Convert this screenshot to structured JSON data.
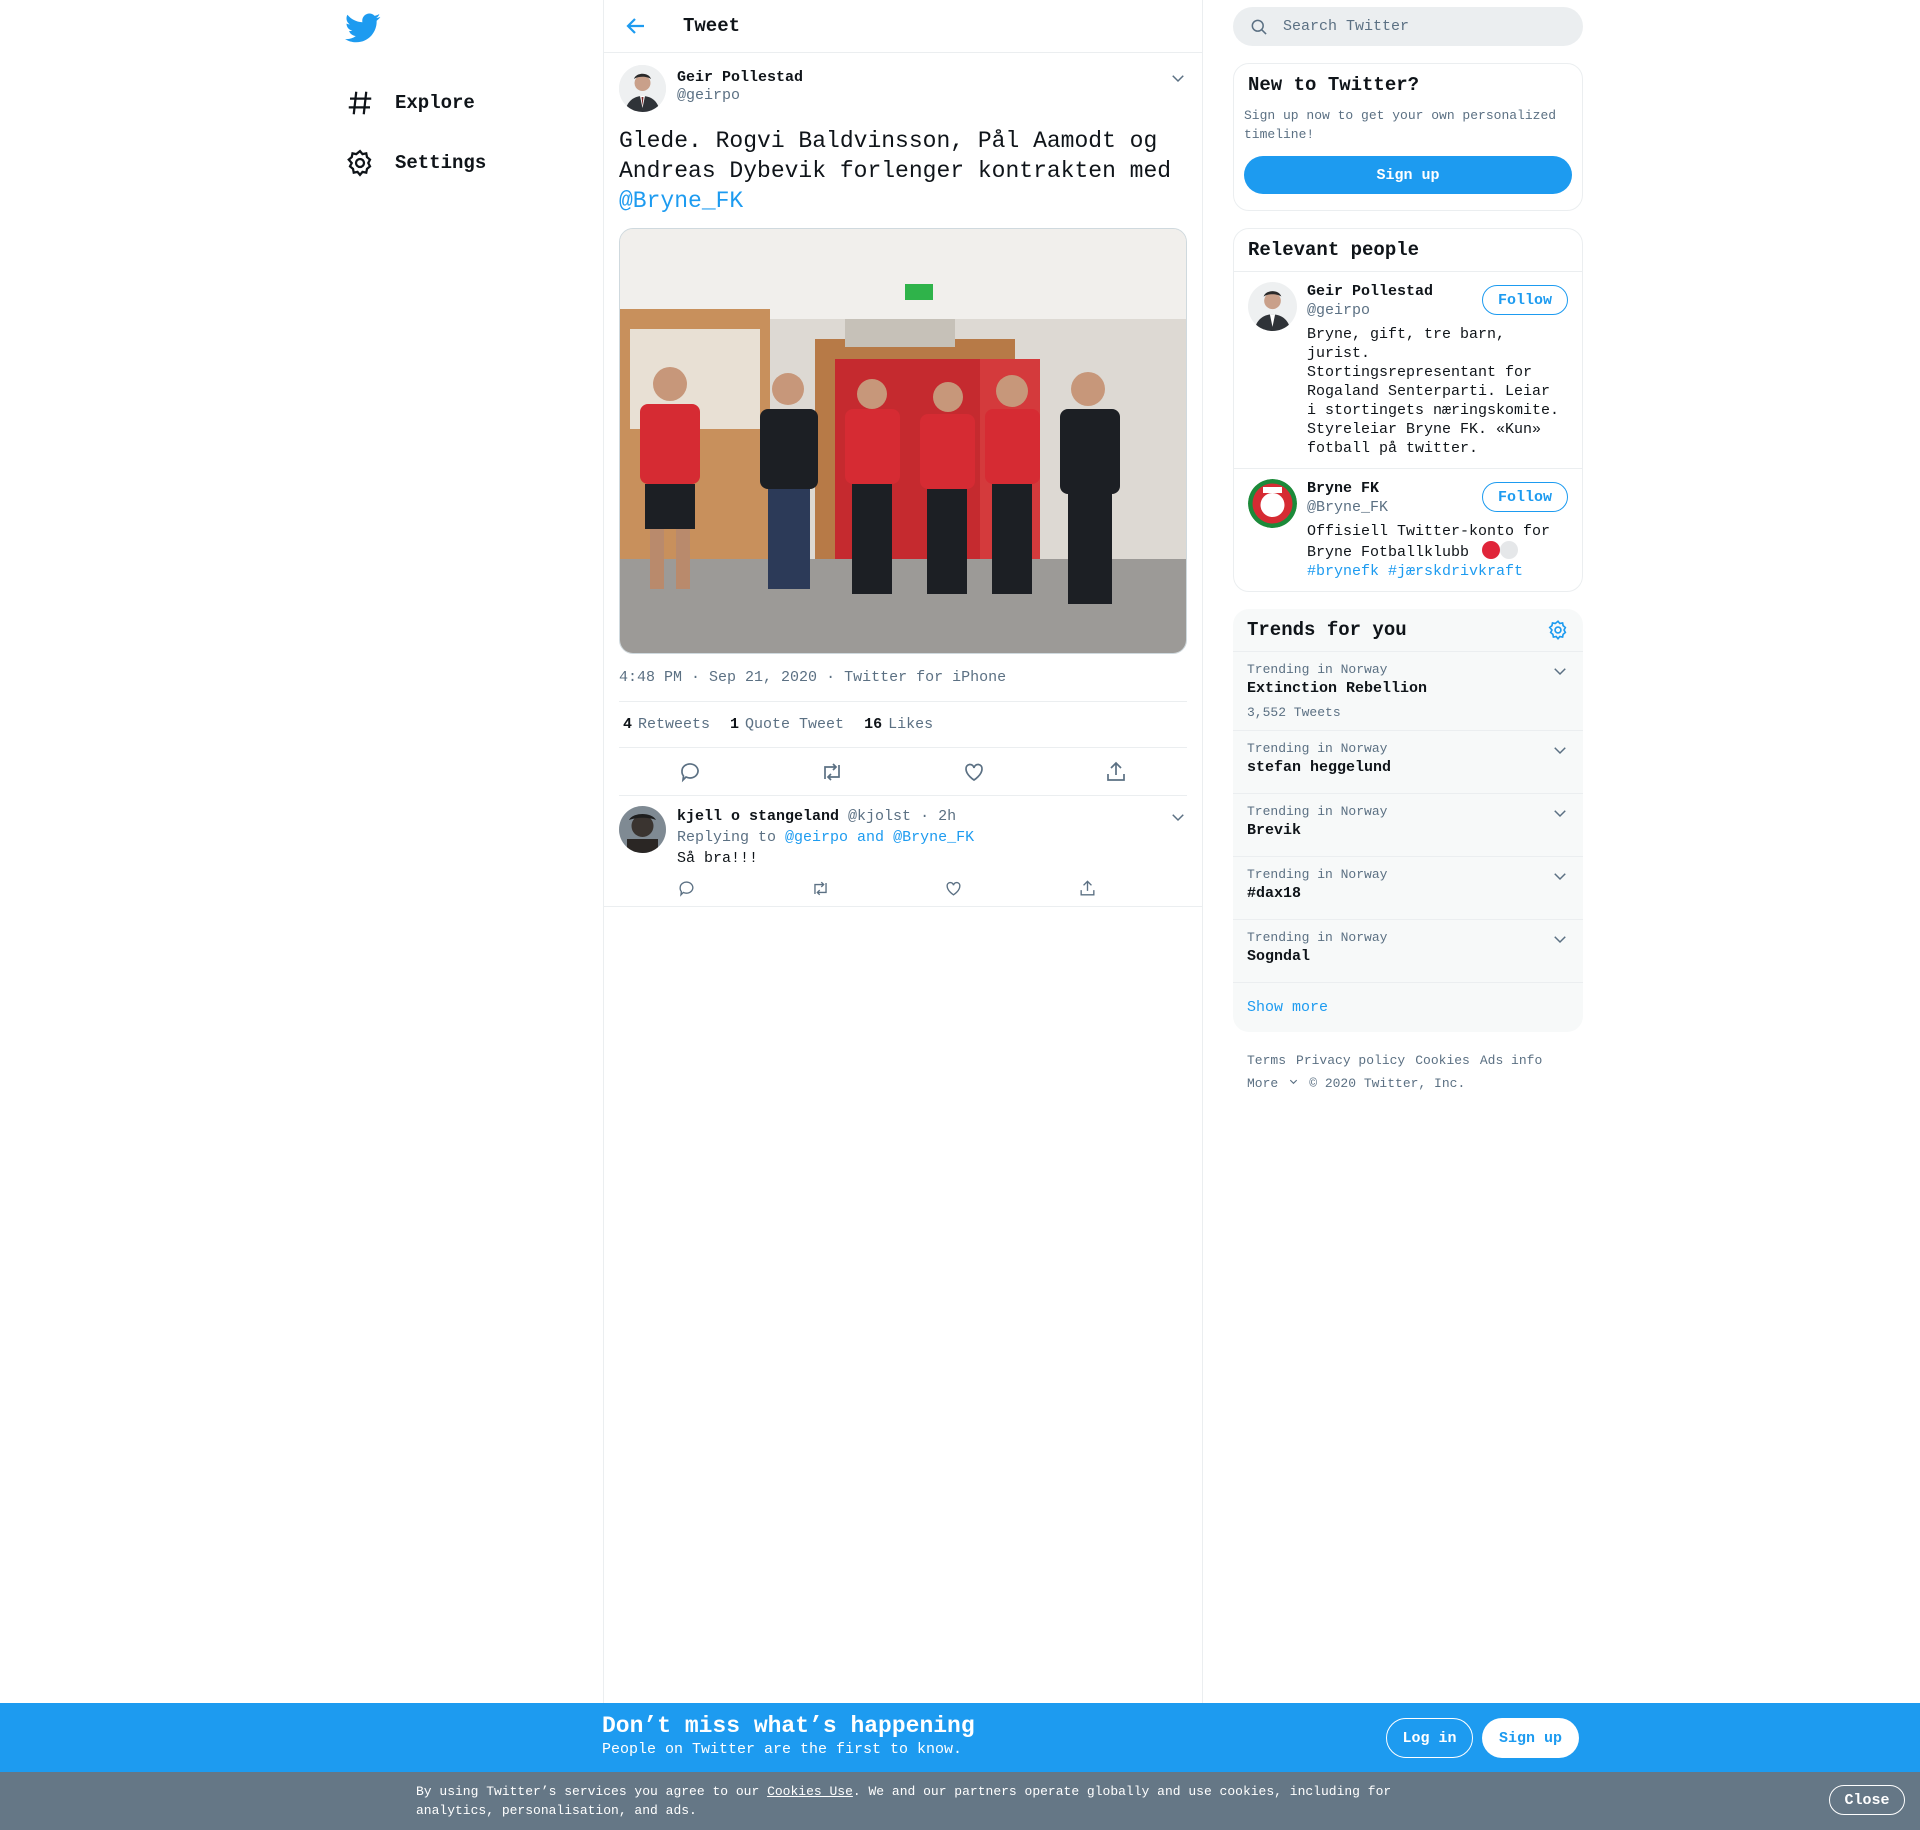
{
  "nav": {
    "items": [
      {
        "label": "Explore",
        "icon": "hashtag-icon"
      },
      {
        "label": "Settings",
        "icon": "gear-icon"
      }
    ]
  },
  "header": {
    "title": "Tweet"
  },
  "tweet": {
    "author_name": "Geir Pollestad",
    "author_handle": "@geirpo",
    "text": "Glede. Rogvi Baldvinsson, Pål Aamodt og Andreas Dybevik forlenger kontrakten med",
    "mention": "@Bryne_FK",
    "time": "4:48 PM · Sep 21, 2020",
    "source": "Twitter for iPhone",
    "retweets": "4",
    "retweets_label": "Retweets",
    "quotes": "1",
    "quotes_label": "Quote Tweet",
    "likes": "16",
    "likes_label": "Likes"
  },
  "reply": {
    "name": "kjell o stangeland",
    "handle": "@kjolst",
    "time": "· 2h",
    "replying_label": "Replying to",
    "replying_to": "@geirpo and @Bryne_FK",
    "text": "Så bra!!!"
  },
  "search": {
    "placeholder": "Search Twitter"
  },
  "new_to_twitter": {
    "title": "New to Twitter?",
    "subtitle": "Sign up now to get your own personalized timeline!",
    "button": "Sign up"
  },
  "relevant": {
    "title": "Relevant people",
    "people": [
      {
        "name": "Geir Pollestad",
        "handle": "@geirpo",
        "bio": "Bryne, gift, tre barn, jurist. Stortingsrepresentant for Rogaland Senterparti. Leiar i stortingets næringskomite. Styreleiar Bryne FK. «Kun» fotball på twitter.",
        "follow": "Follow"
      },
      {
        "name": "Bryne FK",
        "handle": "@Bryne_FK",
        "bio": "Offisiell Twitter-konto for Bryne Fotballklubb",
        "hashtags": "#brynefk #jærskdrivkraft",
        "follow": "Follow"
      }
    ]
  },
  "trends": {
    "title": "Trends for you",
    "items": [
      {
        "context": "Trending in Norway",
        "name": "Extinction Rebellion",
        "count": "3,552 Tweets"
      },
      {
        "context": "Trending in Norway",
        "name": "stefan heggelund"
      },
      {
        "context": "Trending in Norway",
        "name": "Brevik"
      },
      {
        "context": "Trending in Norway",
        "name": "#dax18"
      },
      {
        "context": "Trending in Norway",
        "name": "Sogndal"
      }
    ],
    "show_more": "Show more"
  },
  "footer": {
    "links": [
      "Terms",
      "Privacy policy",
      "Cookies",
      "Ads info"
    ],
    "more": "More",
    "copyright": "© 2020 Twitter, Inc."
  },
  "banner": {
    "title": "Don’t miss what’s happening",
    "subtitle": "People on Twitter are the first to know.",
    "login": "Log in",
    "signup": "Sign up"
  },
  "cookie": {
    "pre": "By using Twitter’s services you agree to our ",
    "link": "Cookies Use",
    "post": ". We and our partners operate globally and use cookies, including for analytics, personalisation, and ads.",
    "close": "Close"
  },
  "colors": {
    "accent": "#1d9bf0",
    "bryne_red": "#e0253a",
    "cookie_bg": "#657786"
  }
}
